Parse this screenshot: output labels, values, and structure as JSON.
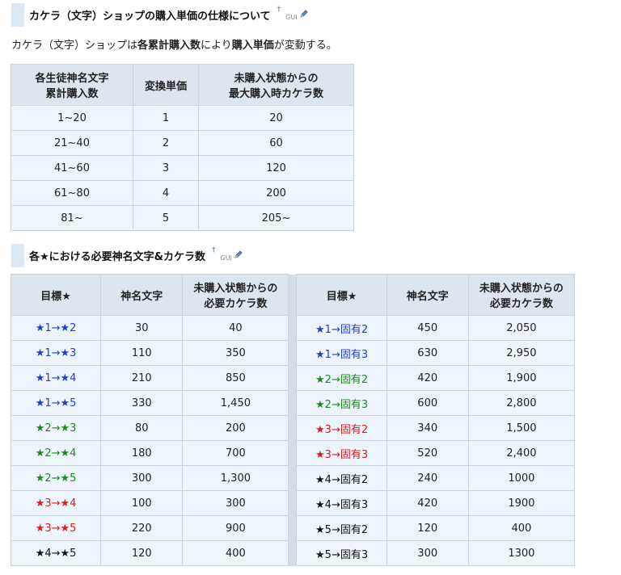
{
  "section1": {
    "heading": "カケラ（文字）ショップの購入単価の仕様について",
    "dagger": "†",
    "gui": "GUI",
    "intro": {
      "part1": "カケラ（文字）ショップは",
      "bold1": "各累計購入数",
      "part2": "により",
      "bold2": "購入単価",
      "part3": "が変動する。"
    },
    "table": {
      "headers": [
        [
          "各生徒神名文字",
          "累計購入数"
        ],
        [
          "変換単価"
        ],
        [
          "未購入状態からの",
          "最大購入時カケラ数"
        ]
      ],
      "rows": [
        [
          "1~20",
          "1",
          "20"
        ],
        [
          "21~40",
          "2",
          "60"
        ],
        [
          "41~60",
          "3",
          "120"
        ],
        [
          "61~80",
          "4",
          "200"
        ],
        [
          "81~",
          "5",
          "205~"
        ]
      ]
    }
  },
  "section2": {
    "heading": "各★における必要神名文字&カケラ数",
    "dagger": "†",
    "gui": "GUI",
    "table": {
      "headers": [
        [
          "目標★"
        ],
        [
          "神名文字"
        ],
        [
          "未購入状態からの",
          "必要カケラ数"
        ],
        [
          "目標★"
        ],
        [
          "神名文字"
        ],
        [
          "未購入状態からの",
          "必要カケラ数"
        ]
      ],
      "rows": [
        {
          "left": {
            "target": "★1→★2",
            "color": "#1f3fd0",
            "letters": "30",
            "kakera": "40"
          },
          "right": {
            "target": "★1→固有2",
            "color": "#1f3fd0",
            "letters": "450",
            "kakera": "2,050"
          }
        },
        {
          "left": {
            "target": "★1→★3",
            "color": "#1f3fd0",
            "letters": "110",
            "kakera": "350"
          },
          "right": {
            "target": "★1→固有3",
            "color": "#1f3fd0",
            "letters": "630",
            "kakera": "2,950"
          }
        },
        {
          "left": {
            "target": "★1→★4",
            "color": "#1f3fd0",
            "letters": "210",
            "kakera": "850"
          },
          "right": {
            "target": "★2→固有2",
            "color": "#1a8a1a",
            "letters": "420",
            "kakera": "1,900"
          }
        },
        {
          "left": {
            "target": "★1→★5",
            "color": "#1f3fd0",
            "letters": "330",
            "kakera": "1,450"
          },
          "right": {
            "target": "★2→固有3",
            "color": "#1a8a1a",
            "letters": "600",
            "kakera": "2,800"
          }
        },
        {
          "left": {
            "target": "★2→★3",
            "color": "#1a8a1a",
            "letters": "80",
            "kakera": "200"
          },
          "right": {
            "target": "★3→固有2",
            "color": "#e01818",
            "letters": "340",
            "kakera": "1,500"
          }
        },
        {
          "left": {
            "target": "★2→★4",
            "color": "#1a8a1a",
            "letters": "180",
            "kakera": "700"
          },
          "right": {
            "target": "★3→固有3",
            "color": "#e01818",
            "letters": "520",
            "kakera": "2,400"
          }
        },
        {
          "left": {
            "target": "★2→★5",
            "color": "#1a8a1a",
            "letters": "300",
            "kakera": "1,300"
          },
          "right": {
            "target": "★4→固有2",
            "color": "#111111",
            "letters": "240",
            "kakera": "1000"
          }
        },
        {
          "left": {
            "target": "★3→★4",
            "color": "#e01818",
            "letters": "100",
            "kakera": "300"
          },
          "right": {
            "target": "★4→固有3",
            "color": "#111111",
            "letters": "420",
            "kakera": "1900"
          }
        },
        {
          "left": {
            "target": "★3→★5",
            "color": "#e01818",
            "letters": "220",
            "kakera": "900"
          },
          "right": {
            "target": "★5→固有2",
            "color": "#111111",
            "letters": "120",
            "kakera": "400"
          }
        },
        {
          "left": {
            "target": "★4→★5",
            "color": "#111111",
            "letters": "120",
            "kakera": "400"
          },
          "right": {
            "target": "★5→固有3",
            "color": "#111111",
            "letters": "300",
            "kakera": "1300"
          }
        }
      ]
    }
  },
  "icons": {
    "edit": "pencil-icon"
  }
}
